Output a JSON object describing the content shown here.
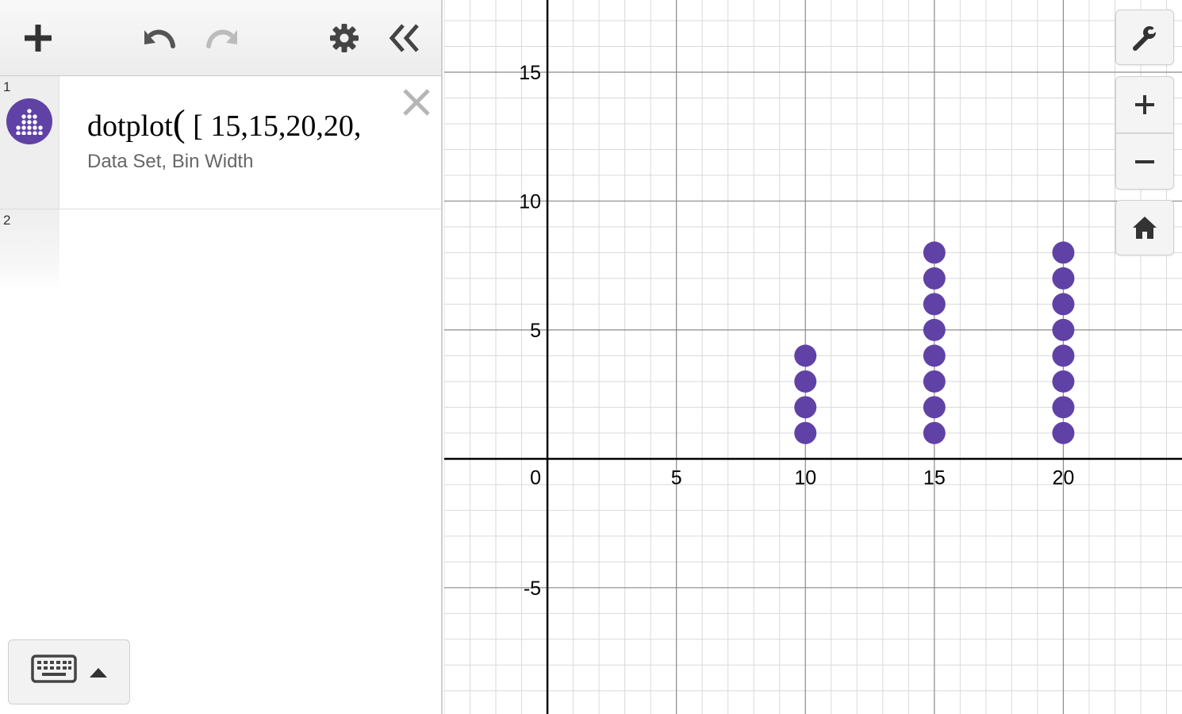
{
  "expression_list": {
    "expressions": [
      {
        "index": "1",
        "formula_prefix": "dotplot",
        "formula_data": "15,15,20,20,",
        "hint": "Data Set,  Bin Width"
      },
      {
        "index": "2"
      }
    ]
  },
  "toolbar": {
    "add_icon": "plus-icon",
    "undo_icon": "undo-icon",
    "redo_icon": "redo-icon",
    "settings_icon": "gear-icon",
    "collapse_icon": "double-chevron-left-icon"
  },
  "graph_controls": [
    "wrench-icon",
    "zoom-in-icon",
    "zoom-out-icon",
    "home-icon"
  ],
  "colors": {
    "dot": "#6042a6"
  },
  "chart_data": {
    "type": "scatter",
    "x_ticks": [
      "5",
      "10",
      "15",
      "20"
    ],
    "y_ticks": [
      "15",
      "10",
      "5",
      "-5"
    ],
    "origin_label": "0",
    "xlim": [
      -4,
      24.6
    ],
    "ylim": [
      -9.9,
      17.8
    ],
    "grid": true,
    "series": [
      {
        "points": [
          {
            "x": 10,
            "y": 1
          },
          {
            "x": 10,
            "y": 2
          },
          {
            "x": 10,
            "y": 3
          },
          {
            "x": 10,
            "y": 4
          },
          {
            "x": 15,
            "y": 1
          },
          {
            "x": 15,
            "y": 2
          },
          {
            "x": 15,
            "y": 3
          },
          {
            "x": 15,
            "y": 4
          },
          {
            "x": 15,
            "y": 5
          },
          {
            "x": 15,
            "y": 6
          },
          {
            "x": 15,
            "y": 7
          },
          {
            "x": 15,
            "y": 8
          },
          {
            "x": 20,
            "y": 1
          },
          {
            "x": 20,
            "y": 2
          },
          {
            "x": 20,
            "y": 3
          },
          {
            "x": 20,
            "y": 4
          },
          {
            "x": 20,
            "y": 5
          },
          {
            "x": 20,
            "y": 6
          },
          {
            "x": 20,
            "y": 7
          },
          {
            "x": 20,
            "y": 8
          }
        ]
      }
    ]
  }
}
